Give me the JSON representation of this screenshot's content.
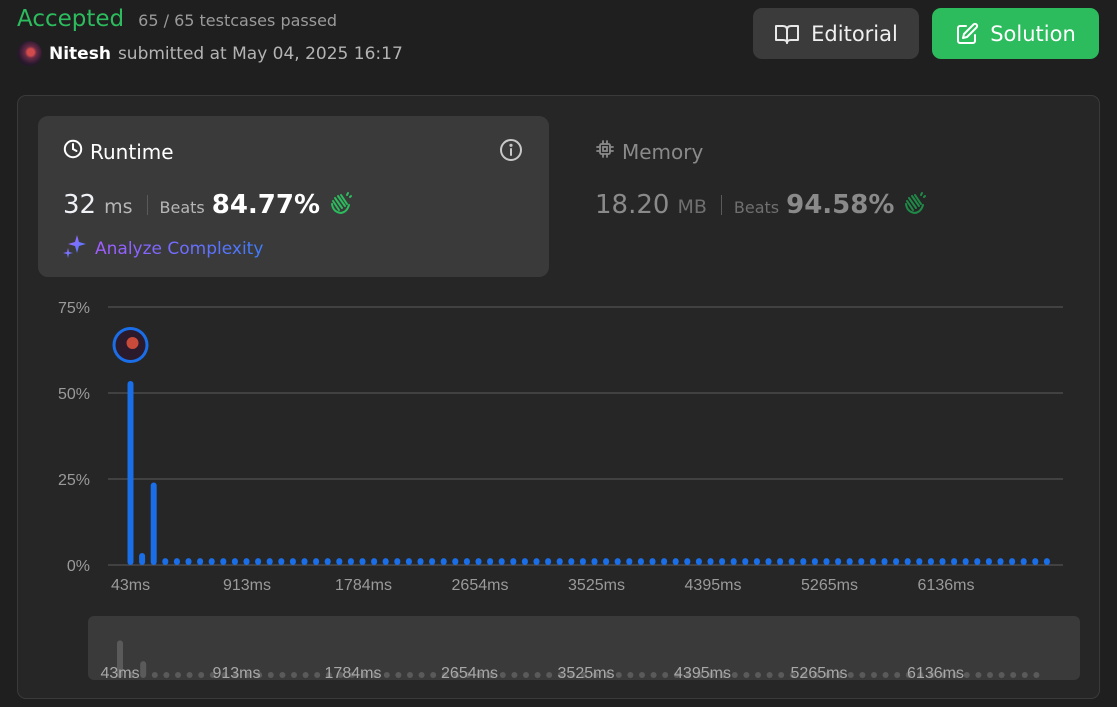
{
  "header": {
    "status": "Accepted",
    "testcases": "65 / 65 testcases passed",
    "username": "Nitesh",
    "submitted": "submitted at May 04, 2025 16:17",
    "editorial_label": "Editorial",
    "solution_label": "Solution"
  },
  "runtime": {
    "title": "Runtime",
    "value": "32",
    "unit": "ms",
    "beats_label": "Beats",
    "beats": "84.77%",
    "analyze": "Analyze Complexity"
  },
  "memory": {
    "title": "Memory",
    "value": "18.20",
    "unit": "MB",
    "beats_label": "Beats",
    "beats": "94.58%"
  },
  "colors": {
    "accent_green": "#2cbb5d",
    "bar_blue": "#1a6ee8",
    "gridline": "#4a4a4a"
  },
  "chart_data": {
    "type": "bar",
    "y_ticks": [
      "75%",
      "50%",
      "25%",
      "0%"
    ],
    "y_values": [
      75,
      50,
      25,
      0
    ],
    "ylim": [
      0,
      75
    ],
    "x_tick_labels": [
      "43ms",
      "913ms",
      "1784ms",
      "2654ms",
      "3525ms",
      "4395ms",
      "5265ms",
      "6136ms"
    ],
    "bar_count": 80,
    "highlighted_bar_index": 0,
    "values": [
      53.5,
      3.5,
      24,
      2,
      2,
      2,
      2,
      2,
      2,
      2,
      2,
      2,
      2,
      2,
      2,
      2,
      2,
      2,
      2,
      2,
      2,
      2,
      2,
      2,
      2,
      2,
      2,
      2,
      2,
      2,
      2,
      2,
      2,
      2,
      2,
      2,
      2,
      2,
      2,
      2,
      2,
      2,
      2,
      2,
      2,
      2,
      2,
      2,
      2,
      2,
      2,
      2,
      2,
      2,
      2,
      2,
      2,
      2,
      2,
      2,
      2,
      2,
      2,
      2,
      2,
      2,
      2,
      2,
      2,
      2,
      2,
      2,
      2,
      2,
      2,
      2,
      2,
      2,
      2,
      2
    ],
    "grid": true
  }
}
